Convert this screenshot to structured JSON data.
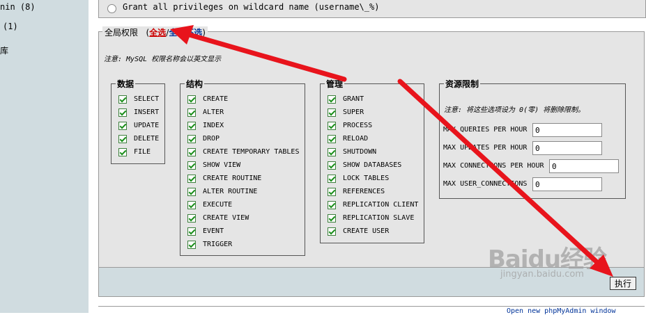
{
  "sidebar": {
    "items": [
      {
        "label": "nin (8)"
      },
      {
        "label": "(1)"
      },
      {
        "label": "库"
      }
    ]
  },
  "top_option": {
    "label": "Grant all privileges on wildcard name (username\\_%)"
  },
  "global_privileges": {
    "title": "全局权限",
    "paren_open": "(",
    "select_all": "全选",
    "slash": "/",
    "deselect_all": "全部不选",
    "paren_close": ")",
    "note": "注意: MySQL 权限名称会以英文显示"
  },
  "groups": {
    "data": {
      "title": "数据",
      "items": [
        "SELECT",
        "INSERT",
        "UPDATE",
        "DELETE",
        "FILE"
      ]
    },
    "structure": {
      "title": "结构",
      "items": [
        "CREATE",
        "ALTER",
        "INDEX",
        "DROP",
        "CREATE TEMPORARY TABLES",
        "SHOW VIEW",
        "CREATE ROUTINE",
        "ALTER ROUTINE",
        "EXECUTE",
        "CREATE VIEW",
        "EVENT",
        "TRIGGER"
      ]
    },
    "admin": {
      "title": "管理",
      "items": [
        "GRANT",
        "SUPER",
        "PROCESS",
        "RELOAD",
        "SHUTDOWN",
        "SHOW DATABASES",
        "LOCK TABLES",
        "REFERENCES",
        "REPLICATION CLIENT",
        "REPLICATION SLAVE",
        "CREATE USER"
      ]
    },
    "resources": {
      "title": "资源限制",
      "note": "注意: 将这些选项设为 0(零) 将删除限制。",
      "fields": [
        {
          "label": "MAX QUERIES PER HOUR",
          "value": "0"
        },
        {
          "label": "MAX UPDATES PER HOUR",
          "value": "0"
        },
        {
          "label": "MAX CONNECTIONS PER HOUR",
          "value": "0"
        },
        {
          "label": "MAX USER_CONNECTIONS",
          "value": "0"
        }
      ]
    }
  },
  "footer": {
    "execute_label": "执行",
    "bottom_link": "Open new phpMyAdmin window"
  },
  "watermark": {
    "logo": "Baidu经验",
    "sub": "jingyan.baidu.com"
  },
  "colors": {
    "arrow": "#e8141c",
    "panel": "#e5e5e5",
    "sidebar": "#d0dce0",
    "check": "#1b8f1b"
  }
}
